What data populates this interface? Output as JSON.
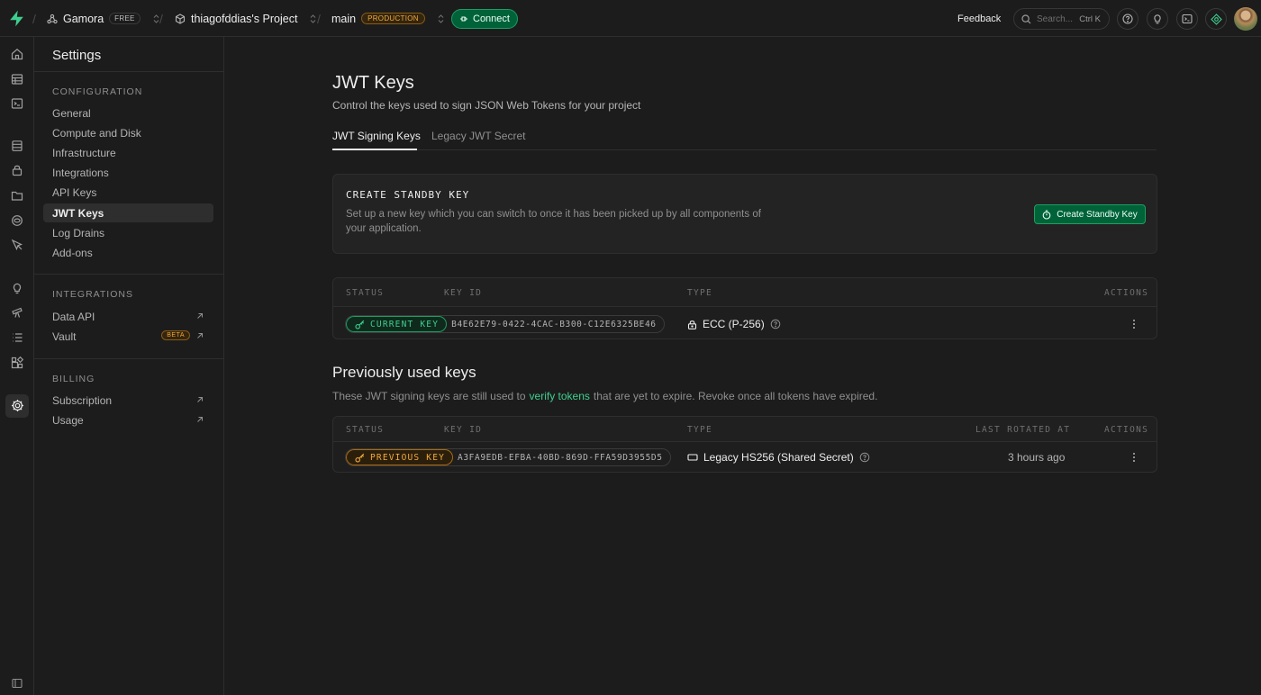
{
  "topbar": {
    "org_name": "Gamora",
    "org_plan": "FREE",
    "project_name": "thiagofddias's Project",
    "branch_name": "main",
    "branch_env": "PRODUCTION",
    "connect_label": "Connect",
    "feedback_label": "Feedback",
    "search_placeholder": "Search...",
    "search_shortcut": "Ctrl K"
  },
  "rail": {
    "icons": [
      "home-icon",
      "table-editor-icon",
      "sql-editor-icon",
      "database-icon",
      "auth-icon",
      "storage-icon",
      "edge-functions-icon",
      "realtime-icon",
      "advisors-icon",
      "reports-icon",
      "logs-icon",
      "integrations-icon",
      "settings-icon",
      "collapse-sidebar-icon"
    ]
  },
  "sidebar": {
    "title": "Settings",
    "configuration_heading": "CONFIGURATION",
    "configuration_items": [
      "General",
      "Compute and Disk",
      "Infrastructure",
      "Integrations",
      "API Keys",
      "JWT Keys",
      "Log Drains",
      "Add-ons"
    ],
    "active_item": "JWT Keys",
    "integrations_heading": "INTEGRATIONS",
    "integrations_items": [
      "Data API",
      "Vault"
    ],
    "vault_badge": "BETA",
    "billing_heading": "BILLING",
    "billing_items": [
      "Subscription",
      "Usage"
    ]
  },
  "main": {
    "title": "JWT Keys",
    "subtitle": "Control the keys used to sign JSON Web Tokens for your project",
    "tabs": [
      {
        "label": "JWT Signing Keys",
        "active": true
      },
      {
        "label": "Legacy JWT Secret",
        "active": false
      }
    ],
    "standby": {
      "title": "CREATE STANDBY KEY",
      "description": "Set up a new key which you can switch to once it has been picked up by all components of your application.",
      "button_label": "Create Standby Key"
    },
    "current_table": {
      "headers": {
        "status": "STATUS",
        "key_id": "KEY ID",
        "type": "TYPE",
        "actions": "ACTIONS"
      },
      "row": {
        "status": "CURRENT KEY",
        "key_id": "B4E62E79-0422-4CAC-B300-C12E6325BE46",
        "type": "ECC (P-256)"
      }
    },
    "previous": {
      "title": "Previously used keys",
      "desc_before": "These JWT signing keys are still used to",
      "desc_link": "verify tokens",
      "desc_after": "that are yet to expire. Revoke once all tokens have expired.",
      "headers": {
        "status": "STATUS",
        "key_id": "KEY ID",
        "type": "TYPE",
        "last_rotated": "LAST ROTATED AT",
        "actions": "ACTIONS"
      },
      "row": {
        "status": "PREVIOUS KEY",
        "key_id": "A3FA9EDB-EFBA-40BD-869D-FFA59D3955D5",
        "type": "Legacy HS256 (Shared Secret)",
        "last_rotated": "3 hours ago"
      }
    }
  },
  "colors": {
    "brand_green": "#3ecf8e",
    "warning_amber": "#f3a93b",
    "background": "#1c1c1c"
  }
}
